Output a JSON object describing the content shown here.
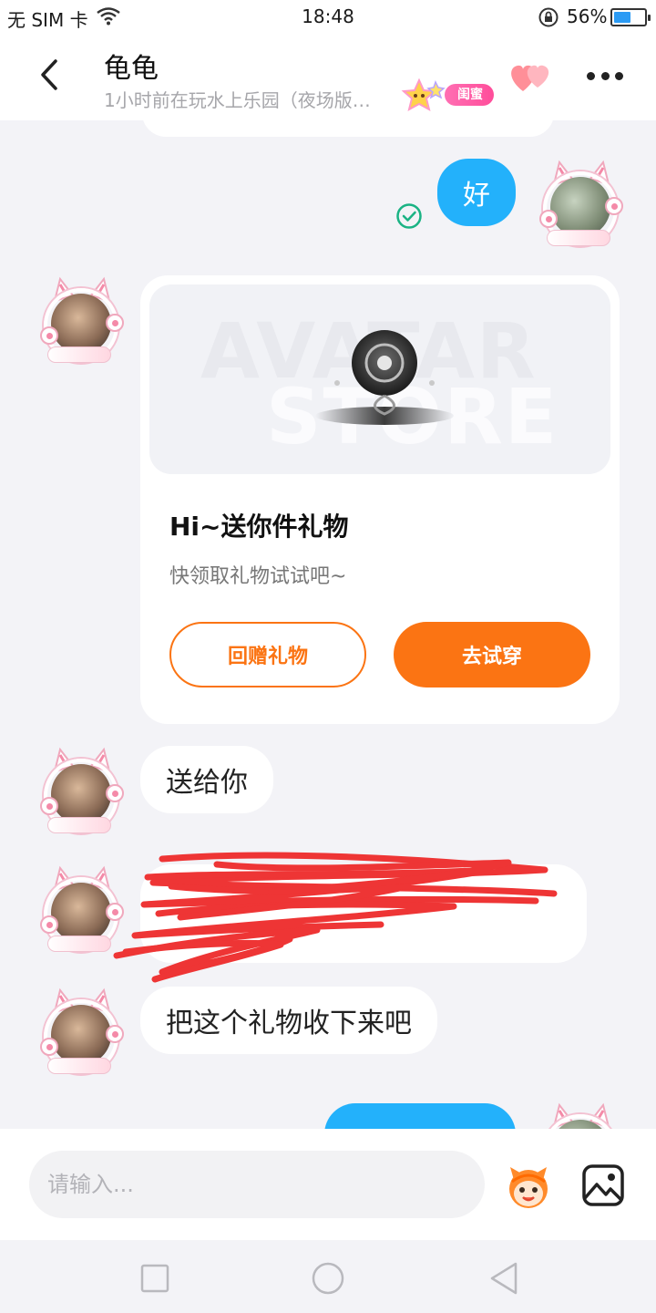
{
  "status_bar": {
    "carrier": "无 SIM 卡",
    "time": "18:48",
    "battery": "56%",
    "battery_level": 0.56
  },
  "header": {
    "name": "龟龟",
    "status": "1小时前在玩水上乐园（夜场版…",
    "badge": "闺蜜"
  },
  "messages": [
    {
      "id": "m1",
      "side": "out",
      "text": "好",
      "read": true
    },
    {
      "id": "m2",
      "side": "in",
      "type": "gift_card",
      "banner_watermark": [
        "AVATAR",
        "STORE"
      ],
      "title": "Hi~送你件礼物",
      "subtitle": "快领取礼物试试吧~",
      "buttons": {
        "return_gift": "回赠礼物",
        "try_on": "去试穿"
      }
    },
    {
      "id": "m3",
      "side": "in",
      "text": "送给你"
    },
    {
      "id": "m4",
      "side": "in",
      "text": "",
      "scribbled": true
    },
    {
      "id": "m5",
      "side": "in",
      "text": "把这个礼物收下来吧"
    },
    {
      "id": "m6",
      "side": "out",
      "text": ""
    }
  ],
  "input": {
    "placeholder": "请输入..."
  },
  "colors": {
    "accent_blue": "#23b1fb",
    "accent_orange": "#fb7413",
    "badge_pink": "#ff4d9a",
    "scribble_red": "#ee2b2b"
  }
}
